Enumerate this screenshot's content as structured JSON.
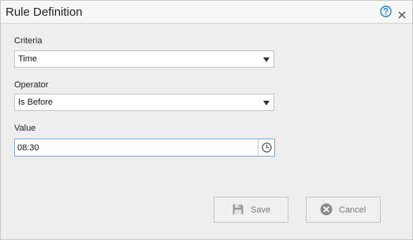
{
  "dialog": {
    "title": "Rule Definition",
    "help_icon": "help-circle-icon",
    "close_icon": "close-icon"
  },
  "form": {
    "criteria": {
      "label": "Criteria",
      "value": "Time"
    },
    "operator": {
      "label": "Operator",
      "value": "Is Before"
    },
    "value_field": {
      "label": "Value",
      "value": "08:30",
      "icon": "clock-icon"
    }
  },
  "buttons": {
    "save_label": "Save",
    "save_icon": "floppy-disk-icon",
    "save_enabled": false,
    "cancel_label": "Cancel",
    "cancel_icon": "x-circle-icon"
  },
  "colors": {
    "accent": "#1e7fd0",
    "focus_border": "#76a8d8",
    "disabled_text": "#7a7a7a"
  }
}
